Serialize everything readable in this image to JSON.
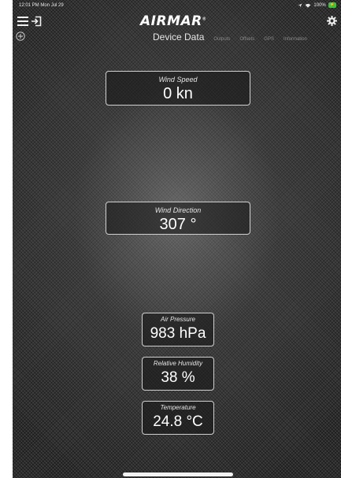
{
  "status_bar": {
    "time_date": "12:01 PM  Mon Jul 29",
    "battery": "100%"
  },
  "header": {
    "logo": "AIRMAR",
    "logo_mark": "®"
  },
  "tabs": [
    {
      "label": "Device Data",
      "active": true
    },
    {
      "label": "Outputs",
      "active": false
    },
    {
      "label": "Offsets",
      "active": false
    },
    {
      "label": "GPS",
      "active": false
    },
    {
      "label": "Information",
      "active": false
    }
  ],
  "readouts": {
    "wind_speed": {
      "label": "Wind Speed",
      "value": "0 kn"
    },
    "wind_direction": {
      "label": "Wind Direction",
      "value": "307 °"
    },
    "air_pressure": {
      "label": "Air Pressure",
      "value": "983 hPa"
    },
    "relative_humidity": {
      "label": "Relative Humidity",
      "value": "38 %"
    },
    "temperature": {
      "label": "Temperature",
      "value": "24.8 °C"
    }
  },
  "icons": {
    "menu": "hamburger-menu-icon",
    "exit": "exit-icon",
    "add": "add-circle-icon",
    "settings": "gear-icon",
    "location": "location-arrow-icon",
    "wifi": "wifi-icon",
    "battery": "battery-icon"
  },
  "colors": {
    "battery": "#3cc13c",
    "text": "#ffffff",
    "tab_inactive": "#8a8a8a"
  }
}
